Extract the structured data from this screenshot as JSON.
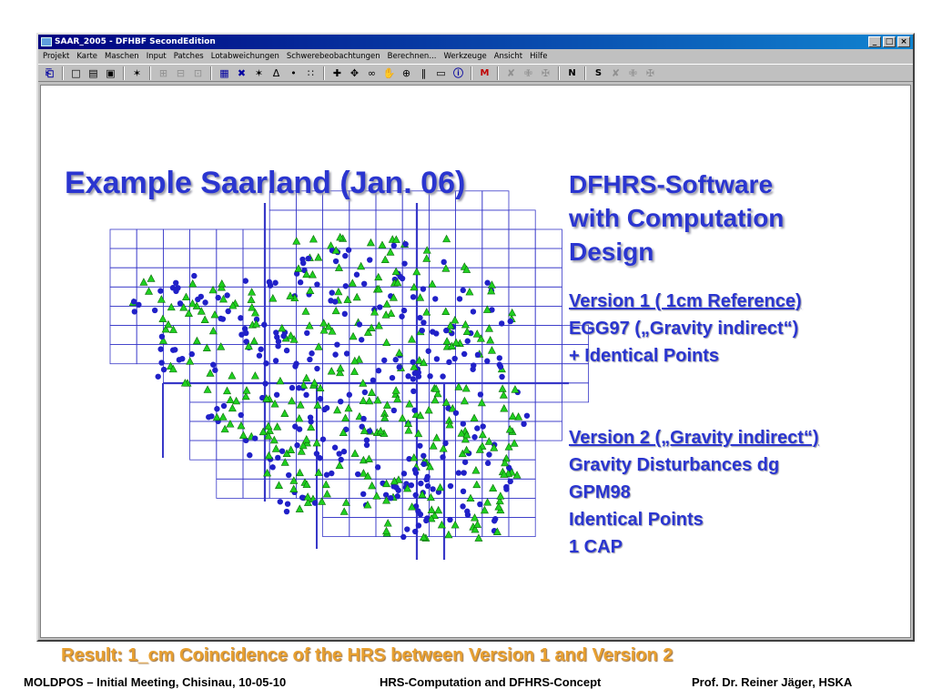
{
  "window": {
    "title": "SAAR_2005 - DFHBF SecondEdition",
    "controls": [
      "_",
      "□",
      "×"
    ]
  },
  "menu": [
    "Projekt",
    "Karte",
    "Maschen",
    "Input",
    "Patches",
    "Lotabweichungen",
    "Schwerebeobachtungen",
    "Berechnen...",
    "Werkzeuge",
    "Ansicht",
    "Hilfe"
  ],
  "toolbar": [
    {
      "icon": "exit-icon",
      "glyph": "⎗",
      "style": "blue"
    },
    {
      "sep": true
    },
    {
      "icon": "new-file-icon",
      "glyph": "□",
      "style": ""
    },
    {
      "icon": "open-folder-icon",
      "glyph": "▤",
      "style": ""
    },
    {
      "icon": "save-icon",
      "glyph": "▣",
      "style": ""
    },
    {
      "sep": true
    },
    {
      "icon": "deflection-icon",
      "glyph": "✶",
      "style": ""
    },
    {
      "sep": true
    },
    {
      "icon": "grid-icon",
      "glyph": "⊞",
      "style": "gray"
    },
    {
      "icon": "grid-points-icon",
      "glyph": "⊟",
      "style": "gray"
    },
    {
      "icon": "grid-select-icon",
      "glyph": "⊡",
      "style": "gray"
    },
    {
      "sep": true
    },
    {
      "icon": "mesh-icon",
      "glyph": "▦",
      "style": "blue"
    },
    {
      "icon": "cross-icon",
      "glyph": "✖",
      "style": "blue"
    },
    {
      "icon": "vertical-deflection-icon",
      "glyph": "✶",
      "style": ""
    },
    {
      "icon": "delta-query-icon",
      "glyph": "Δ",
      "style": ""
    },
    {
      "icon": "point-query-icon",
      "glyph": "•",
      "style": ""
    },
    {
      "icon": "mesh-query-icon",
      "glyph": "∷",
      "style": ""
    },
    {
      "sep": true
    },
    {
      "icon": "add-point-icon",
      "glyph": "✚",
      "style": ""
    },
    {
      "icon": "move-icon",
      "glyph": "✥",
      "style": ""
    },
    {
      "icon": "link-icon",
      "glyph": "∞",
      "style": ""
    },
    {
      "icon": "hand-icon",
      "glyph": "✋",
      "style": ""
    },
    {
      "icon": "zoom-icon",
      "glyph": "⊕",
      "style": ""
    },
    {
      "icon": "split-icon",
      "glyph": "‖",
      "style": ""
    },
    {
      "icon": "display-icon",
      "glyph": "▭",
      "style": ""
    },
    {
      "icon": "info-icon",
      "glyph": "ⓘ",
      "style": "blue"
    },
    {
      "sep": true
    },
    {
      "icon": "m-icon",
      "glyph": "M",
      "style": "red"
    },
    {
      "sep": true
    },
    {
      "icon": "tool-a-icon",
      "glyph": "✘",
      "style": "gray"
    },
    {
      "icon": "tool-b-icon",
      "glyph": "✙",
      "style": "gray"
    },
    {
      "icon": "tool-c-icon",
      "glyph": "✠",
      "style": "gray"
    },
    {
      "sep": true
    },
    {
      "icon": "n-icon",
      "glyph": "N",
      "style": "bold"
    },
    {
      "sep": true
    },
    {
      "icon": "s-icon",
      "glyph": "S",
      "style": "bold"
    },
    {
      "icon": "tool-d-icon",
      "glyph": "✘",
      "style": "gray"
    },
    {
      "icon": "tool-e-icon",
      "glyph": "✙",
      "style": "gray"
    },
    {
      "icon": "tool-f-icon",
      "glyph": "✠",
      "style": "gray"
    }
  ],
  "slide": {
    "title": "Example Saarland (Jan. 06)",
    "heading_lines": [
      "DFHRS-Software",
      "with Computation",
      "Design"
    ],
    "version1": {
      "lines": [
        "Version 1 ( 1cm Reference)",
        "EGG97 („Gravity indirect“)",
        "+ Identical Points"
      ]
    },
    "version2": {
      "lines": [
        "Version 2 („Gravity indirect“)",
        "Gravity Disturbances dg",
        "GPM98",
        "Identical Points",
        "1 CAP"
      ]
    },
    "result": "Result: 1_cm Coincidence of the HRS between Version 1 and Version 2"
  },
  "map": {
    "grid_color": "#3838c8",
    "triangle_color": "#20d020",
    "dot_color": "#2020c8"
  },
  "footer": {
    "left": "MOLDPOS – Initial Meeting, Chisinau, 10-05-10",
    "center": "HRS-Computation and DFHRS-Concept",
    "right": "Prof. Dr. Reiner Jäger, HSKA"
  }
}
